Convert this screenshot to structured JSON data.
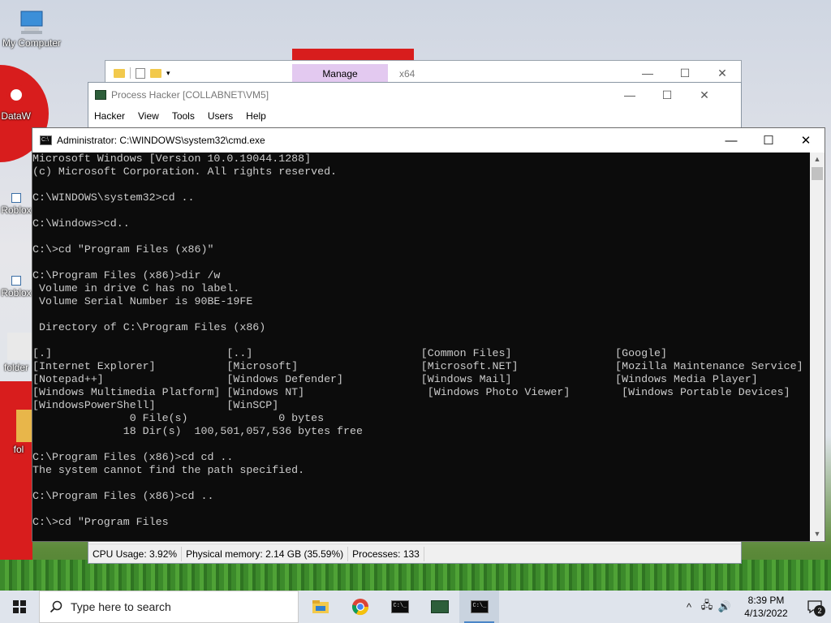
{
  "desktop": {
    "icons": [
      {
        "label": "My Computer"
      },
      {
        "label": "DataW"
      },
      {
        "label": "Roblox"
      },
      {
        "label": "Roblox"
      },
      {
        "label": "folder"
      },
      {
        "label": "fol"
      }
    ]
  },
  "explorer": {
    "manage_tab": "Manage",
    "path_hint": "x64",
    "controls": {
      "minimize": "—",
      "maximize": "☐",
      "close": "✕"
    }
  },
  "process_hacker": {
    "title": "Process Hacker [COLLABNET\\VM5]",
    "menu": [
      "Hacker",
      "View",
      "Tools",
      "Users",
      "Help"
    ],
    "status": {
      "cpu": "CPU Usage: 3.92%",
      "memory": "Physical memory: 2.14 GB (35.59%)",
      "processes": "Processes: 133"
    },
    "controls": {
      "minimize": "—",
      "maximize": "☐",
      "close": "✕"
    },
    "help_icon": "?"
  },
  "cmd": {
    "title": "Administrator: C:\\WINDOWS\\system32\\cmd.exe",
    "controls": {
      "minimize": "—",
      "maximize": "☐",
      "close": "✕"
    },
    "lines": [
      "Microsoft Windows [Version 10.0.19044.1288]",
      "(c) Microsoft Corporation. All rights reserved.",
      "",
      "C:\\WINDOWS\\system32>cd ..",
      "",
      "C:\\Windows>cd..",
      "",
      "C:\\>cd \"Program Files (x86)\"",
      "",
      "C:\\Program Files (x86)>dir /w",
      " Volume in drive C has no label.",
      " Volume Serial Number is 90BE-19FE",
      "",
      " Directory of C:\\Program Files (x86)",
      "",
      "[.]                           [..]                          [Common Files]                [Google]",
      "[Internet Explorer]           [Microsoft]                   [Microsoft.NET]               [Mozilla Maintenance Service]",
      "[Notepad++]                   [Windows Defender]            [Windows Mail]                [Windows Media Player]",
      "[Windows Multimedia Platform] [Windows NT]                   [Windows Photo Viewer]        [Windows Portable Devices]",
      "[WindowsPowerShell]           [WinSCP]",
      "               0 File(s)              0 bytes",
      "              18 Dir(s)  100,501,057,536 bytes free",
      "",
      "C:\\Program Files (x86)>cd cd ..",
      "The system cannot find the path specified.",
      "",
      "C:\\Program Files (x86)>cd ..",
      "",
      "C:\\>cd \"Program Files"
    ]
  },
  "taskbar": {
    "search_placeholder": "Type here to search",
    "apps": [
      {
        "icon": "file-explorer-icon"
      },
      {
        "icon": "chrome-icon"
      },
      {
        "icon": "cmd-icon"
      },
      {
        "icon": "process-hacker-icon"
      },
      {
        "icon": "cmd-icon-active"
      }
    ],
    "tray": {
      "chevron": "^",
      "network": "🖧",
      "volume": "🔊"
    },
    "time": "8:39 PM",
    "date": "4/13/2022",
    "notification_count": "2"
  }
}
